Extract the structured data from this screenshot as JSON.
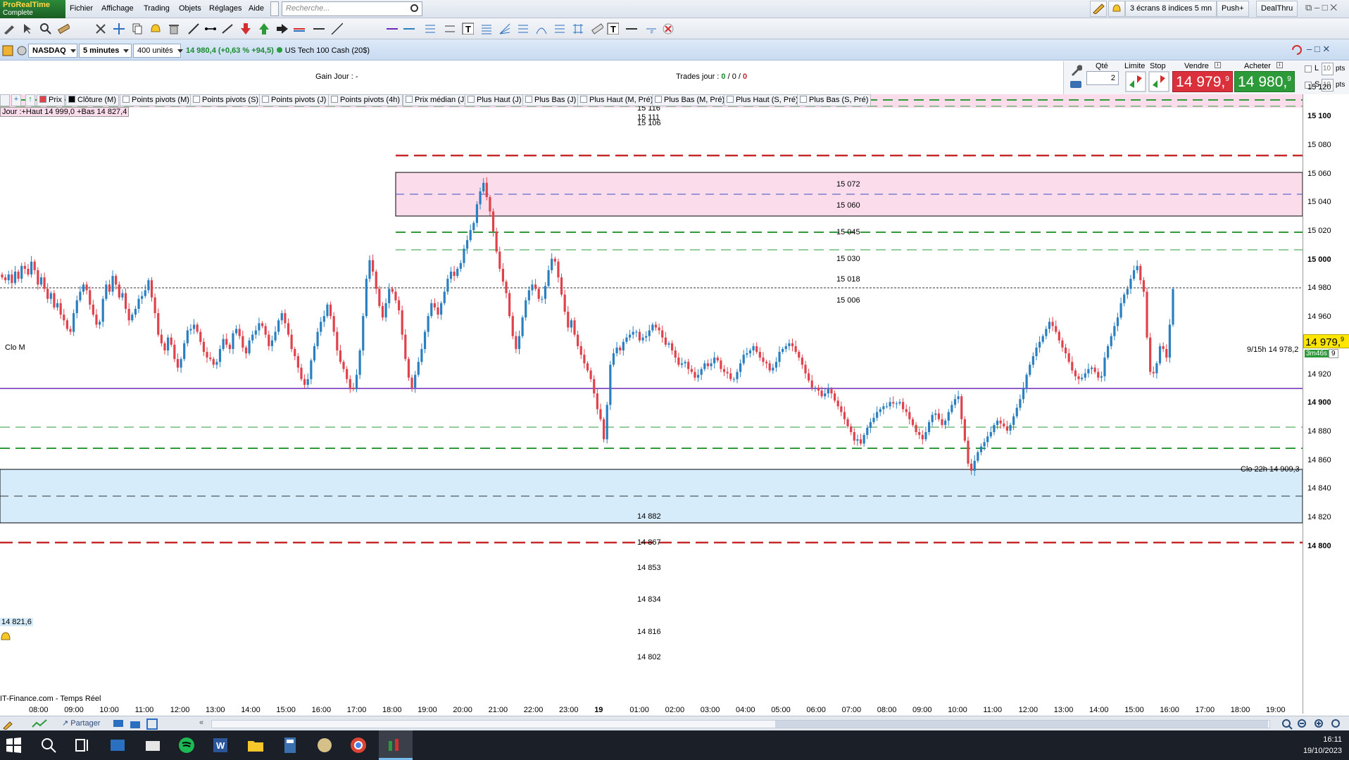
{
  "app": {
    "logo_top": "ProRealTime",
    "logo_bottom": "Complete",
    "menus": [
      "Fichier",
      "Affichage",
      "Trading",
      "Objets",
      "Réglages",
      "Aide"
    ],
    "search_placeholder": "Recherche...",
    "screens_label": "3 écrans 8 indices 5 mn",
    "push_label": "Push+",
    "dealthru_label": "DealThru"
  },
  "chart_header": {
    "market": "NASDAQ",
    "timeframe": "5 minutes",
    "units": "400 unités",
    "price_change": "14 980,4 (+0,63 % +94,5)",
    "instrument": "US Tech 100 Cash (20$)"
  },
  "info": {
    "gain_label": "Gain Jour :",
    "gain_value": "-",
    "trades_label": "Trades jour :",
    "trades_a": "0",
    "trades_b": "0",
    "trades_c": "0"
  },
  "order": {
    "qty_label": "Qté",
    "qty_value": "2",
    "limit_label": "Limite",
    "stop_label": "Stop",
    "sell_label": "Vendre",
    "buy_label": "Acheter",
    "sell_price": "14 979,",
    "sell_sup": "9",
    "buy_price": "14 980,",
    "buy_sup": "9",
    "l_label": "L",
    "s_label": "S",
    "l_value": "10",
    "s_value": "10",
    "pts": "pts"
  },
  "indicators": [
    "Prix",
    "Clôture (M)",
    "Points pivots (M)",
    "Points pivots (S)",
    "Points pivots (J)",
    "Points pivots (4h)",
    "Prix médian (J)",
    "Plus Haut (J)",
    "Plus Bas (J)",
    "Plus Haut (M, Pré)",
    "Plus Bas (M, Pré)",
    "Plus Haut (S, Pré)",
    "Plus Bas (S, Pré)"
  ],
  "chart_texts": {
    "day_range": "Jour :+Haut 14 999,0 +Bas 14 827,4",
    "clo_m": "Clo M",
    "clo_22h": "Clo 22h 14 909,3",
    "time_15h": "9/15h 14 978,2",
    "current_price": "14 979,",
    "current_sup": "9",
    "countdown": "3m46s",
    "countdown_suffix": "9",
    "alert_level": "14 821,6",
    "source": "IT-Finance.com - Temps Réel",
    "share": "Partager"
  },
  "levels": [
    {
      "value": "15 116",
      "y": 15116
    },
    {
      "value": "15 111",
      "y": 15111
    },
    {
      "value": "15 106",
      "y": 15106
    },
    {
      "value": "15 072",
      "y": 15072
    },
    {
      "value": "15 060",
      "y": 15060
    },
    {
      "value": "15 045",
      "y": 15045
    },
    {
      "value": "15 030",
      "y": 15030
    },
    {
      "value": "15 018",
      "y": 15018
    },
    {
      "value": "15 006",
      "y": 15006
    },
    {
      "value": "14 882",
      "y": 14882
    },
    {
      "value": "14 867",
      "y": 14867
    },
    {
      "value": "14 853",
      "y": 14853
    },
    {
      "value": "14 834",
      "y": 14834
    },
    {
      "value": "14 816",
      "y": 14816
    },
    {
      "value": "14 802",
      "y": 14802
    }
  ],
  "yticks": [
    "15 120",
    "15 100",
    "15 080",
    "15 060",
    "15 040",
    "15 020",
    "15 000",
    "14 980",
    "14 960",
    "14 940",
    "14 920",
    "14 900",
    "14 880",
    "14 860",
    "14 840",
    "14 820",
    "14 800"
  ],
  "xticks": [
    "08:00",
    "09:00",
    "10:00",
    "11:00",
    "12:00",
    "13:00",
    "14:00",
    "15:00",
    "16:00",
    "17:00",
    "18:00",
    "19:00",
    "20:00",
    "21:00",
    "22:00",
    "23:00",
    "19",
    "01:00",
    "02:00",
    "03:00",
    "04:00",
    "05:00",
    "06:00",
    "07:00",
    "08:00",
    "09:00",
    "10:00",
    "11:00",
    "12:00",
    "13:00",
    "14:00",
    "15:00",
    "16:00",
    "17:00",
    "18:00",
    "19:00"
  ],
  "clock": {
    "time": "16:11",
    "date": "19/10/2023"
  },
  "colors": {
    "up": "#2a7fc0",
    "down": "#e0424c",
    "pink_zone": "#fbdcea",
    "blue_zone": "#d6ecfb",
    "green_dash": "#2e9a3a",
    "red_dash": "#c42a2a",
    "purple": "#6b2bb5"
  },
  "chart_data": {
    "type": "candlestick",
    "ylim": [
      14792,
      15128
    ],
    "current": 14979.9,
    "closes": [
      14988,
      14986,
      14990,
      14984,
      14992,
      14987,
      14996,
      14994,
      14990,
      14999,
      14993,
      14983,
      14988,
      14980,
      14973,
      14977,
      14967,
      14970,
      14962,
      14958,
      14952,
      14950,
      14963,
      14972,
      14978,
      14983,
      14979,
      14969,
      14962,
      14955,
      14957,
      14973,
      14983,
      14978,
      14989,
      14983,
      14974,
      14977,
      14966,
      14958,
      14962,
      14966,
      14973,
      14975,
      14979,
      14986,
      14974,
      14963,
      14948,
      14942,
      14937,
      14946,
      14941,
      14931,
      14925,
      14931,
      14942,
      14951,
      14952,
      14955,
      14950,
      14943,
      14936,
      14932,
      14931,
      14927,
      14929,
      14938,
      14945,
      14941,
      14938,
      14949,
      14952,
      14947,
      14939,
      14935,
      14944,
      14948,
      14951,
      14956,
      14954,
      14948,
      14940,
      14944,
      14950,
      14958,
      14963,
      14956,
      14948,
      14938,
      14933,
      14925,
      14917,
      14913,
      14917,
      14930,
      14940,
      14950,
      14957,
      14961,
      14969,
      14961,
      14950,
      14937,
      14929,
      14924,
      14917,
      14911,
      14910,
      14920,
      14937,
      14961,
      14987,
      15000,
      14992,
      14980,
      14968,
      14960,
      14970,
      14980,
      14978,
      14972,
      14965,
      14948,
      14931,
      14918,
      14911,
      14920,
      14929,
      14938,
      14950,
      14961,
      14970,
      14967,
      14962,
      14970,
      14978,
      14987,
      14992,
      14989,
      14994,
      14998,
      15008,
      15014,
      15021,
      15026,
      15039,
      15048,
      15054,
      15044,
      15034,
      15020,
      15006,
      14994,
      14985,
      14977,
      14961,
      14947,
      14938,
      14947,
      14960,
      14972,
      14979,
      14983,
      14980,
      14973,
      14973,
      14982,
      14993,
      15001,
      14999,
      14988,
      14976,
      14964,
      14953,
      14958,
      14948,
      14940,
      14934,
      14928,
      14923,
      14917,
      14907,
      14896,
      14889,
      14875,
      14899,
      14927,
      14935,
      14939,
      14937,
      14943,
      14946,
      14948,
      14950,
      14950,
      14944,
      14946,
      14947,
      14951,
      14955,
      14953,
      14951,
      14946,
      14941,
      14942,
      14937,
      14932,
      14927,
      14928,
      14929,
      14924,
      14922,
      14918,
      14920,
      14924,
      14928,
      14926,
      14928,
      14932,
      14930,
      14924,
      14922,
      14921,
      14917,
      14917,
      14922,
      14928,
      14934,
      14935,
      14937,
      14940,
      14936,
      14932,
      14929,
      14928,
      14923,
      14925,
      14929,
      14936,
      14938,
      14940,
      14942,
      14940,
      14936,
      14932,
      14927,
      14921,
      14916,
      14911,
      14911,
      14909,
      14905,
      14907,
      14910,
      14907,
      14902,
      14898,
      14894,
      14889,
      14884,
      14880,
      14874,
      14875,
      14872,
      14878,
      14883,
      14887,
      14890,
      14894,
      14896,
      14898,
      14898,
      14901,
      14900,
      14900,
      14901,
      14896,
      14894,
      14889,
      14885,
      14880,
      14878,
      14875,
      14880,
      14887,
      14892,
      14893,
      14889,
      14885,
      14888,
      14894,
      14899,
      14903,
      14905,
      14889,
      14874,
      14858,
      14853,
      14860,
      14866,
      14870,
      14873,
      14877,
      14880,
      14885,
      14888,
      14886,
      14884,
      14881,
      14885,
      14891,
      14897,
      14903,
      14911,
      14920,
      14927,
      14933,
      14939,
      14943,
      14947,
      14952,
      14957,
      14954,
      14950,
      14944,
      14939,
      14935,
      14929,
      14923,
      14919,
      14917,
      14918,
      14921,
      14924,
      14925,
      14922,
      14918,
      14919,
      14932,
      14940,
      14947,
      14954,
      14960,
      14970,
      14976,
      14980,
      14987,
      14993,
      14996,
      14986,
      14978,
      14946,
      14922,
      14921,
      14928,
      14940,
      14938,
      14932,
      14955,
      14979.9
    ]
  }
}
